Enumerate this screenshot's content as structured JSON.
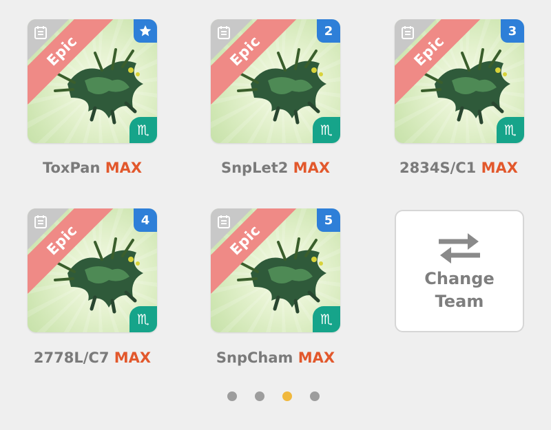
{
  "cards": [
    {
      "rarity": "Epic",
      "badge": "",
      "badge_icon": "star-icon",
      "name": "ToxPan",
      "level": "MAX",
      "sign": "♏"
    },
    {
      "rarity": "Epic",
      "badge": "2",
      "badge_icon": "",
      "name": "SnpLet2",
      "level": "MAX",
      "sign": "♏"
    },
    {
      "rarity": "Epic",
      "badge": "3",
      "badge_icon": "",
      "name": "2834S/C1",
      "level": "MAX",
      "sign": "♏"
    },
    {
      "rarity": "Epic",
      "badge": "4",
      "badge_icon": "",
      "name": "2778L/C7",
      "level": "MAX",
      "sign": "♏"
    },
    {
      "rarity": "Epic",
      "badge": "5",
      "badge_icon": "",
      "name": "SnpCham",
      "level": "MAX",
      "sign": "♏"
    }
  ],
  "change_team": {
    "line1": "Change",
    "line2": "Team",
    "icon": "swap-arrows-icon"
  },
  "pagination": {
    "total": 4,
    "active": 3
  },
  "colors": {
    "background": "#efefef",
    "epic_ribbon": "#ef8a86",
    "badge_blue": "#2e7fd8",
    "sign_green": "#16a48a",
    "max_orange": "#e2582c",
    "name_grey": "#7a7a7a",
    "dot_inactive": "#9d9d9d",
    "dot_active": "#f0b83d"
  }
}
